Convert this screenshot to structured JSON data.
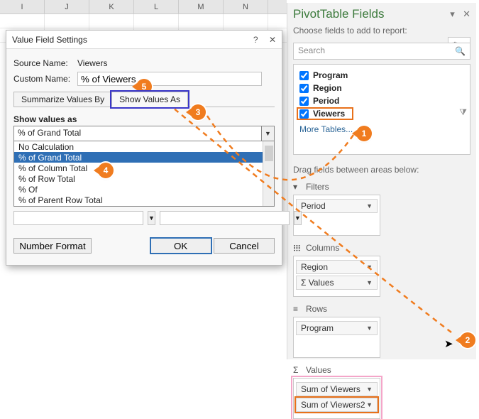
{
  "grid": {
    "columns": [
      "I",
      "J",
      "K",
      "L",
      "M",
      "N"
    ]
  },
  "pane": {
    "title": "PivotTable Fields",
    "subtitle": "Choose fields to add to report:",
    "search_placeholder": "Search",
    "fields": [
      {
        "label": "Program",
        "checked": true,
        "bold": true
      },
      {
        "label": "Region",
        "checked": true,
        "bold": true
      },
      {
        "label": "Period",
        "checked": true,
        "bold": true
      },
      {
        "label": "Viewers",
        "checked": true,
        "bold": true
      }
    ],
    "more": "More Tables...",
    "drag_label": "Drag fields between areas below:",
    "areas": {
      "filters": {
        "title": "Filters",
        "items": [
          {
            "label": "Period"
          }
        ]
      },
      "columns": {
        "title": "Columns",
        "items": [
          {
            "label": "Region"
          },
          {
            "label": "Σ Values"
          }
        ]
      },
      "rows": {
        "title": "Rows",
        "items": [
          {
            "label": "Program"
          }
        ]
      },
      "values": {
        "title": "Values",
        "items": [
          {
            "label": "Sum of Viewers"
          },
          {
            "label": "Sum of Viewers2"
          }
        ]
      }
    }
  },
  "dialog": {
    "title": "Value Field Settings",
    "source_label": "Source Name:",
    "source_value": "Viewers",
    "custom_label": "Custom Name:",
    "custom_value": "% of Viewers",
    "tabs": {
      "summarize": "Summarize Values By",
      "show": "Show Values As"
    },
    "show_label": "Show values as",
    "combo_selected": "% of Grand Total",
    "options": [
      "No Calculation",
      "% of Grand Total",
      "% of Column Total",
      "% of Row Total",
      "% Of",
      "% of Parent Row Total"
    ],
    "number_format": "Number Format",
    "ok": "OK",
    "cancel": "Cancel"
  },
  "callouts": {
    "c1": "1",
    "c2": "2",
    "c3": "3",
    "c4": "4",
    "c5": "5"
  }
}
